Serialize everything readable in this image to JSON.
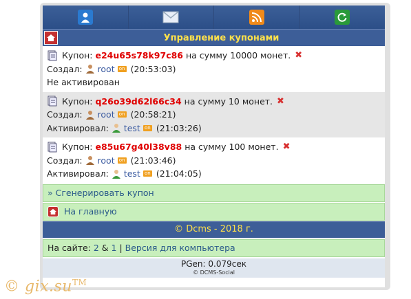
{
  "header": {
    "title": "Управление купонами"
  },
  "coupons": [
    {
      "label": "Купон:",
      "code": "e24u65s78k97c86",
      "amount": "на сумму 10000 монет.",
      "created_label": "Создал:",
      "creator": "root",
      "created_time": "(20:53:03)",
      "status": "Не активирован"
    },
    {
      "label": "Купон:",
      "code": "q26o39d62l66c34",
      "amount": "на сумму 10 монет.",
      "created_label": "Создал:",
      "creator": "root",
      "created_time": "(20:58:21)",
      "activated_label": "Активировал:",
      "activator": "test",
      "activated_time": "(21:03:26)"
    },
    {
      "label": "Купон:",
      "code": "e85u67g40l38v88",
      "amount": "на сумму 100 монет.",
      "created_label": "Создал:",
      "creator": "root",
      "created_time": "(21:03:46)",
      "activated_label": "Активировал:",
      "activator": "test",
      "activated_time": "(21:04:05)"
    }
  ],
  "online_badge": "on",
  "actions": {
    "generate": "» Сгенерировать купон",
    "home": "На главную"
  },
  "footer": {
    "copyright": "© Dcms - 2018 г."
  },
  "online": {
    "label": "На сайте:",
    "count_a": "2",
    "amp": " & ",
    "count_b": "1",
    "sep": " | ",
    "desktop": "Версия для компьютера"
  },
  "pgen": "PGen: 0.079сек",
  "credit": "© DCMS-Social",
  "watermark": {
    "text": "© gix.su",
    "tm": "TM"
  },
  "colors": {
    "accent": "#3d5e98",
    "title": "#ffe14a",
    "code": "#e00000",
    "green": "#c8efbc"
  }
}
